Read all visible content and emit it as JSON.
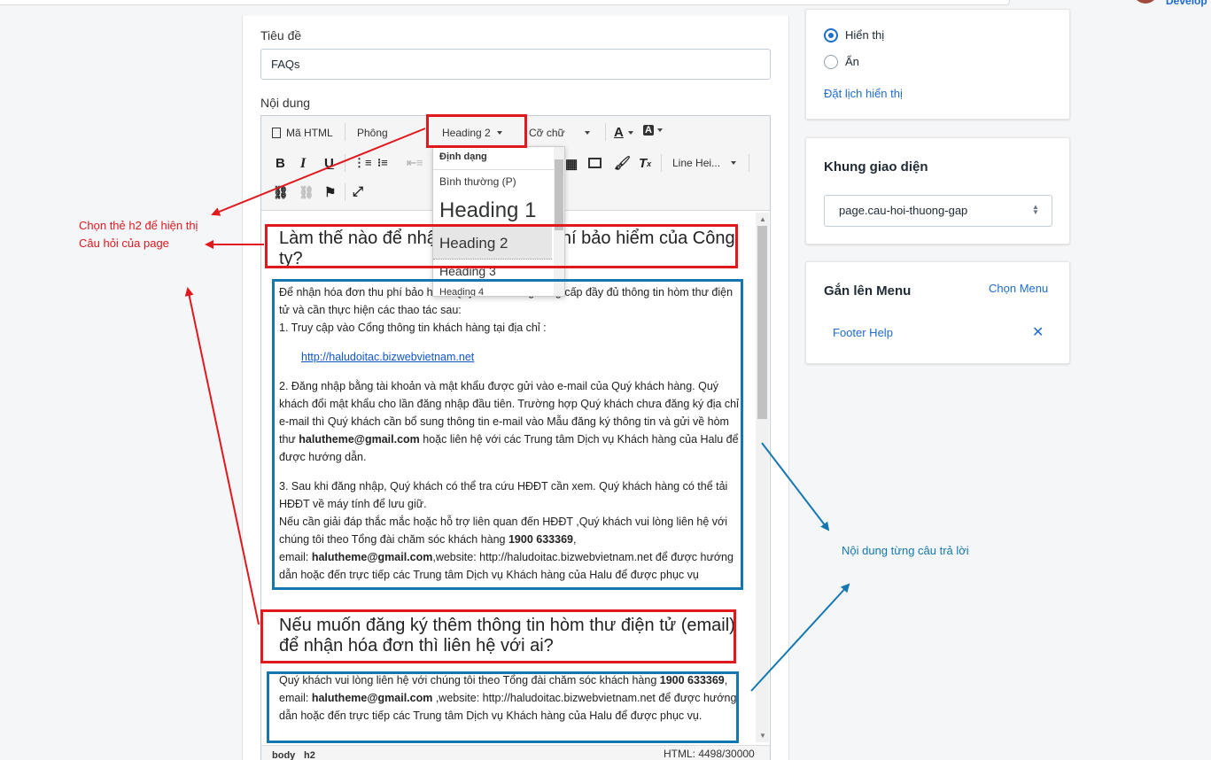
{
  "header": {
    "user_name": "Develop"
  },
  "form": {
    "title_label": "Tiêu đề",
    "title_value": "FAQs",
    "content_label": "Nội dung"
  },
  "toolbar": {
    "html_label": "Mã HTML",
    "font_label": "Phông",
    "format_label": "Heading 2",
    "size_label": "Cỡ chữ",
    "font_color_label": "A",
    "bg_color_label": "A",
    "line_height_label": "Line Hei..."
  },
  "format_dropdown": {
    "header": "Định dạng",
    "items": [
      "Bình thường (P)",
      "Heading 1",
      "Heading 2",
      "Heading 3",
      "Heading 4"
    ]
  },
  "editor_content": {
    "q1": "Làm thế nào để nhận hóa đơn thu phí bảo hiểm của Công ty?",
    "a1_p1": "Để nhận hóa đơn thu phí bảo hiểm Quý khách hàng cung cấp đầy đủ thông tin hòm thư điện tử và cần thực hiện các thao tác sau:",
    "a1_step1": "1. Truy cập vào Cổng thông tin khách hàng tại địa chỉ :",
    "a1_link": "http://haludoitac.bizwebvietnam.net",
    "a1_step2_a": "2. Đăng nhập bằng tài khoản và mật khẩu được gửi vào e-mail của Quý khách hàng. Quý khách đổi mật khẩu cho lần đăng nhập đầu tiên. Trường hợp Quý khách chưa đăng ký địa chỉ e-mail thì Quý khách cần bổ sung thông tin e-mail vào Mẫu đăng ký thông tin và gửi về hòm thư ",
    "a1_step2_email": "halutheme@gmail.com",
    "a1_step2_b": " hoặc liên hệ với các Trung tâm Dịch vụ Khách hàng của Halu để được hướng dẫn.",
    "a1_step3": "3. Sau khi đăng nhập, Quý khách có thể tra cứu HĐĐT cần xem. Quý khách hàng có thể tải HĐĐT về máy tính để lưu giữ.",
    "a1_support_a": "Nếu cần giải đáp thắc mắc hoặc hỗ trợ liên quan đến HĐĐT ,Quý khách vui lòng liên hệ với chúng tôi theo Tổng đài chăm sóc khách hàng ",
    "a1_support_phone": "1900 633369",
    "a1_support_b": ",",
    "a1_email_label": "email: ",
    "a1_email": "halutheme@gmail.com",
    "a1_email_rest": ",website: http://haludoitac.bizwebvietnam.net để được hướng dẫn hoặc đến trực tiếp các Trung tâm Dịch vụ Khách hàng của Halu để được phục vụ",
    "q2": "Nếu muốn đăng ký thêm thông tin hòm thư điện tử (email) để nhận hóa đơn thì liên hệ với ai?",
    "a2_a": "Quý khách vui lòng liên hệ với chúng tôi theo Tổng đài chăm sóc khách hàng ",
    "a2_phone": "1900 633369",
    "a2_b": ", email: ",
    "a2_email": "halutheme@gmail.com",
    "a2_c": " ,website: http://haludoitac.bizwebvietnam.net để được hướng dẫn hoặc đến trực tiếp các Trung tâm Dịch vụ Khách hàng của Halu để được phục vụ."
  },
  "status_bar": {
    "path_body": "body",
    "path_h2": "h2",
    "char_count": "HTML: 4498/30000"
  },
  "visibility": {
    "show_label": "Hiển thị",
    "hide_label": "Ẩn",
    "schedule_link": "Đặt lịch hiển thị",
    "selected": "show"
  },
  "template": {
    "title": "Khung giao diện",
    "selected": "page.cau-hoi-thuong-gap"
  },
  "menu": {
    "title": "Gắn lên Menu",
    "choose_link": "Chọn Menu",
    "items": [
      "Footer Help"
    ]
  },
  "annotations": {
    "red_line1": "Chọn thẻ h2 để hiện thị",
    "red_line2": "Câu hỏi của page",
    "blue": "Nội dung từng câu trả lời"
  },
  "colors": {
    "accent": "#1e6ccf",
    "annotation_red": "#e0191f",
    "annotation_blue": "#1577b0"
  }
}
